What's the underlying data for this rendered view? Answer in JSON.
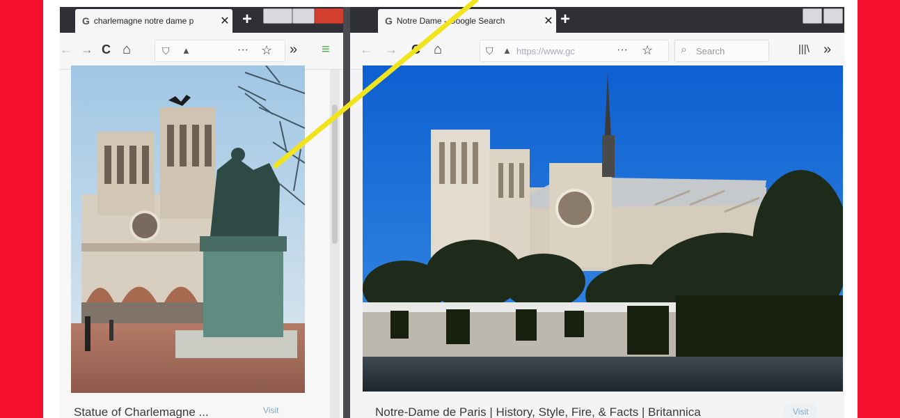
{
  "left_window": {
    "tab_title": "charlemagne notre dame p",
    "tab_icon": "google-g-icon",
    "image_caption": "Statue of Charlemagne ...",
    "visit_label": "Visit"
  },
  "right_window": {
    "tab_title": "Notre Dame - Google Search",
    "tab_icon": "google-g-icon",
    "url": "https://www.gc",
    "search_placeholder": "Search",
    "image_caption": "Notre-Dame de Paris | History, Style, Fire, & Facts | Britannica",
    "visit_label": "Visit"
  },
  "glyphs": {
    "google": "G",
    "close": "✕",
    "new_tab": "+",
    "back": "←",
    "forward": "→",
    "reload": "C",
    "home": "⌂",
    "lock": "🔒",
    "more": "···",
    "star": "☆",
    "overflow": "»",
    "library": "|||\\",
    "menu": "≡",
    "search": "⌕"
  },
  "colors": {
    "red_frame": "#f5102f",
    "annotation_line": "#f2e41c",
    "tab_strip": "#2f3036",
    "visit_text": "#7fa7c8"
  }
}
